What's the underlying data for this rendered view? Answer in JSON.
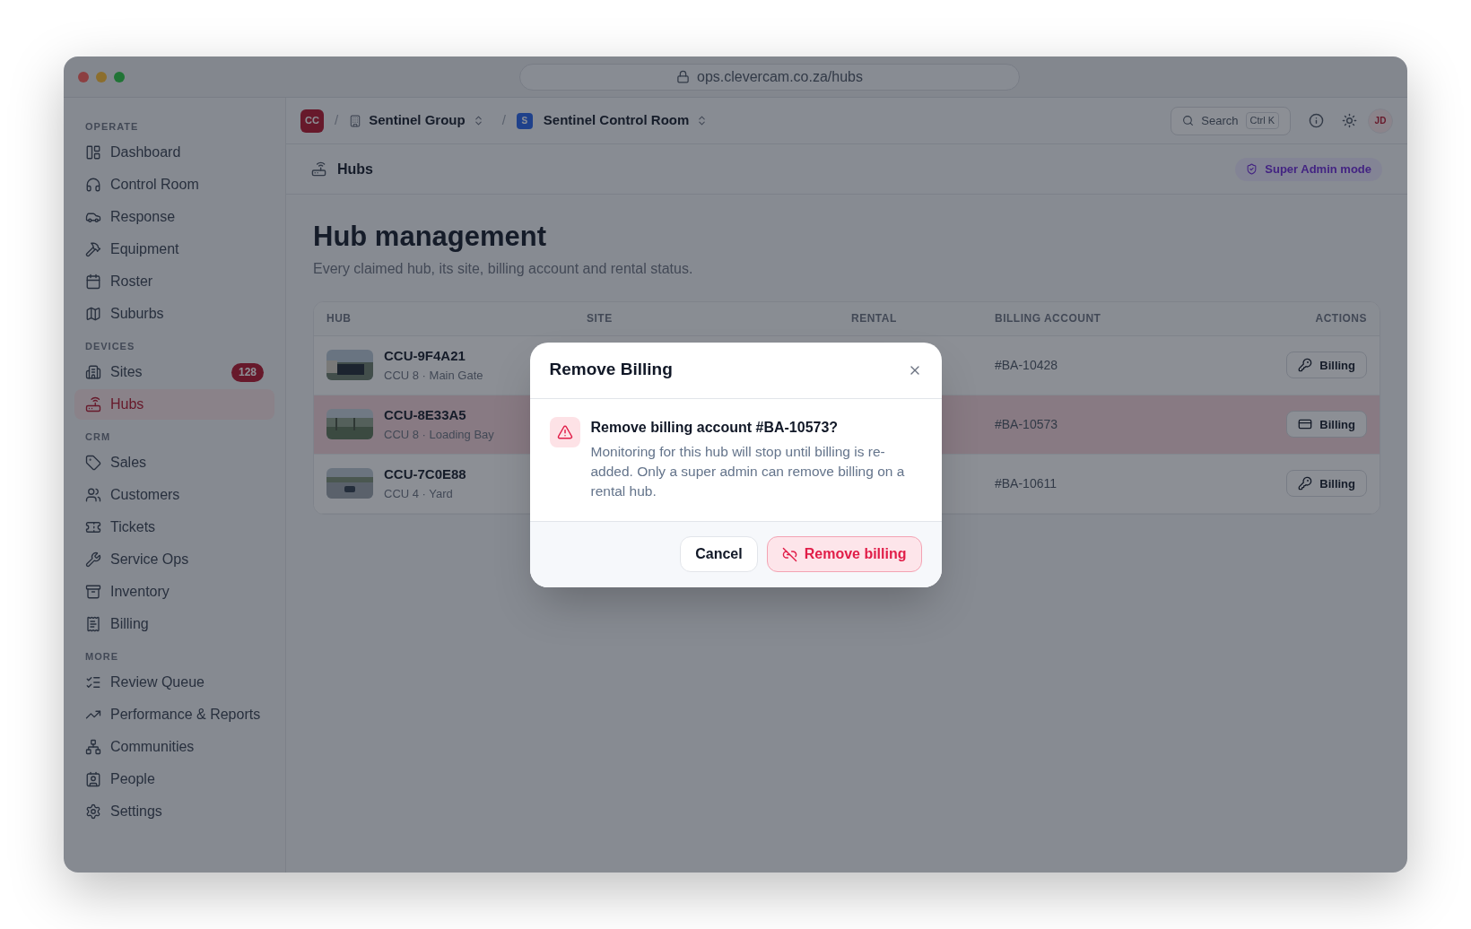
{
  "browser": {
    "url": "ops.clevercam.co.za/hubs"
  },
  "sidebar": {
    "sections": [
      {
        "title": "OPERATE",
        "items": [
          {
            "label": "Dashboard",
            "selected": false
          },
          {
            "label": "Control Room",
            "selected": false
          },
          {
            "label": "Response",
            "selected": false
          },
          {
            "label": "Equipment",
            "selected": false
          },
          {
            "label": "Roster",
            "selected": false
          },
          {
            "label": "Suburbs",
            "selected": false
          }
        ]
      },
      {
        "title": "DEVICES",
        "items": [
          {
            "label": "Sites",
            "badge": "128",
            "selected": false
          },
          {
            "label": "Hubs",
            "selected": true
          }
        ]
      },
      {
        "title": "CRM",
        "items": [
          {
            "label": "Sales",
            "selected": false
          },
          {
            "label": "Customers",
            "selected": false
          },
          {
            "label": "Tickets",
            "selected": false
          },
          {
            "label": "Service Ops",
            "selected": false
          },
          {
            "label": "Inventory",
            "selected": false
          },
          {
            "label": "Billing",
            "selected": false
          }
        ]
      },
      {
        "title": "MORE",
        "items": [
          {
            "label": "Review Queue",
            "selected": false
          },
          {
            "label": "Performance & Reports",
            "selected": false
          },
          {
            "label": "Communities",
            "selected": false
          },
          {
            "label": "People",
            "selected": false
          },
          {
            "label": "Settings",
            "selected": false
          }
        ]
      }
    ]
  },
  "topbar": {
    "org_logo": "CC",
    "separator_1": "/",
    "org": "Sentinel Group",
    "separator_2": "/",
    "site_logo": "S",
    "site": "Sentinel Control Room",
    "search": "Search",
    "shortcut": "Ctrl K",
    "avatar": "JD"
  },
  "page_header": {
    "title": "Hubs",
    "mode_badge": "Super Admin mode"
  },
  "heading": "Hub management",
  "subtitle": "Every claimed hub, its site, billing account and rental status.",
  "table": {
    "columns": [
      "HUB",
      "SITE",
      "RENTAL",
      "BILLING ACCOUNT",
      "ACTIONS"
    ],
    "rows": [
      {
        "hub": "CCU-9F4A21",
        "detail": "CCU 8 · Main Gate",
        "billing_account": "#BA-10428",
        "action": "Billing",
        "kind": "key",
        "selected": false
      },
      {
        "hub": "CCU-8E33A5",
        "detail": "CCU 8 · Loading Bay",
        "billing_account": "#BA-10573",
        "action": "Billing",
        "kind": "card",
        "selected": true
      },
      {
        "hub": "CCU-7C0E88",
        "detail": "CCU 4 · Yard",
        "billing_account": "#BA-10611",
        "action": "Billing",
        "kind": "key",
        "selected": false
      }
    ]
  },
  "dialog": {
    "title": "Remove Billing",
    "question": "Remove billing account #BA-10573?",
    "message": "Monitoring for this hub will stop until billing is re-added. Only a super admin can remove billing on a rental hub.",
    "buttons": [
      {
        "kind": "secondary",
        "label": "Cancel"
      },
      {
        "kind": "danger",
        "label": "Remove billing"
      }
    ]
  }
}
